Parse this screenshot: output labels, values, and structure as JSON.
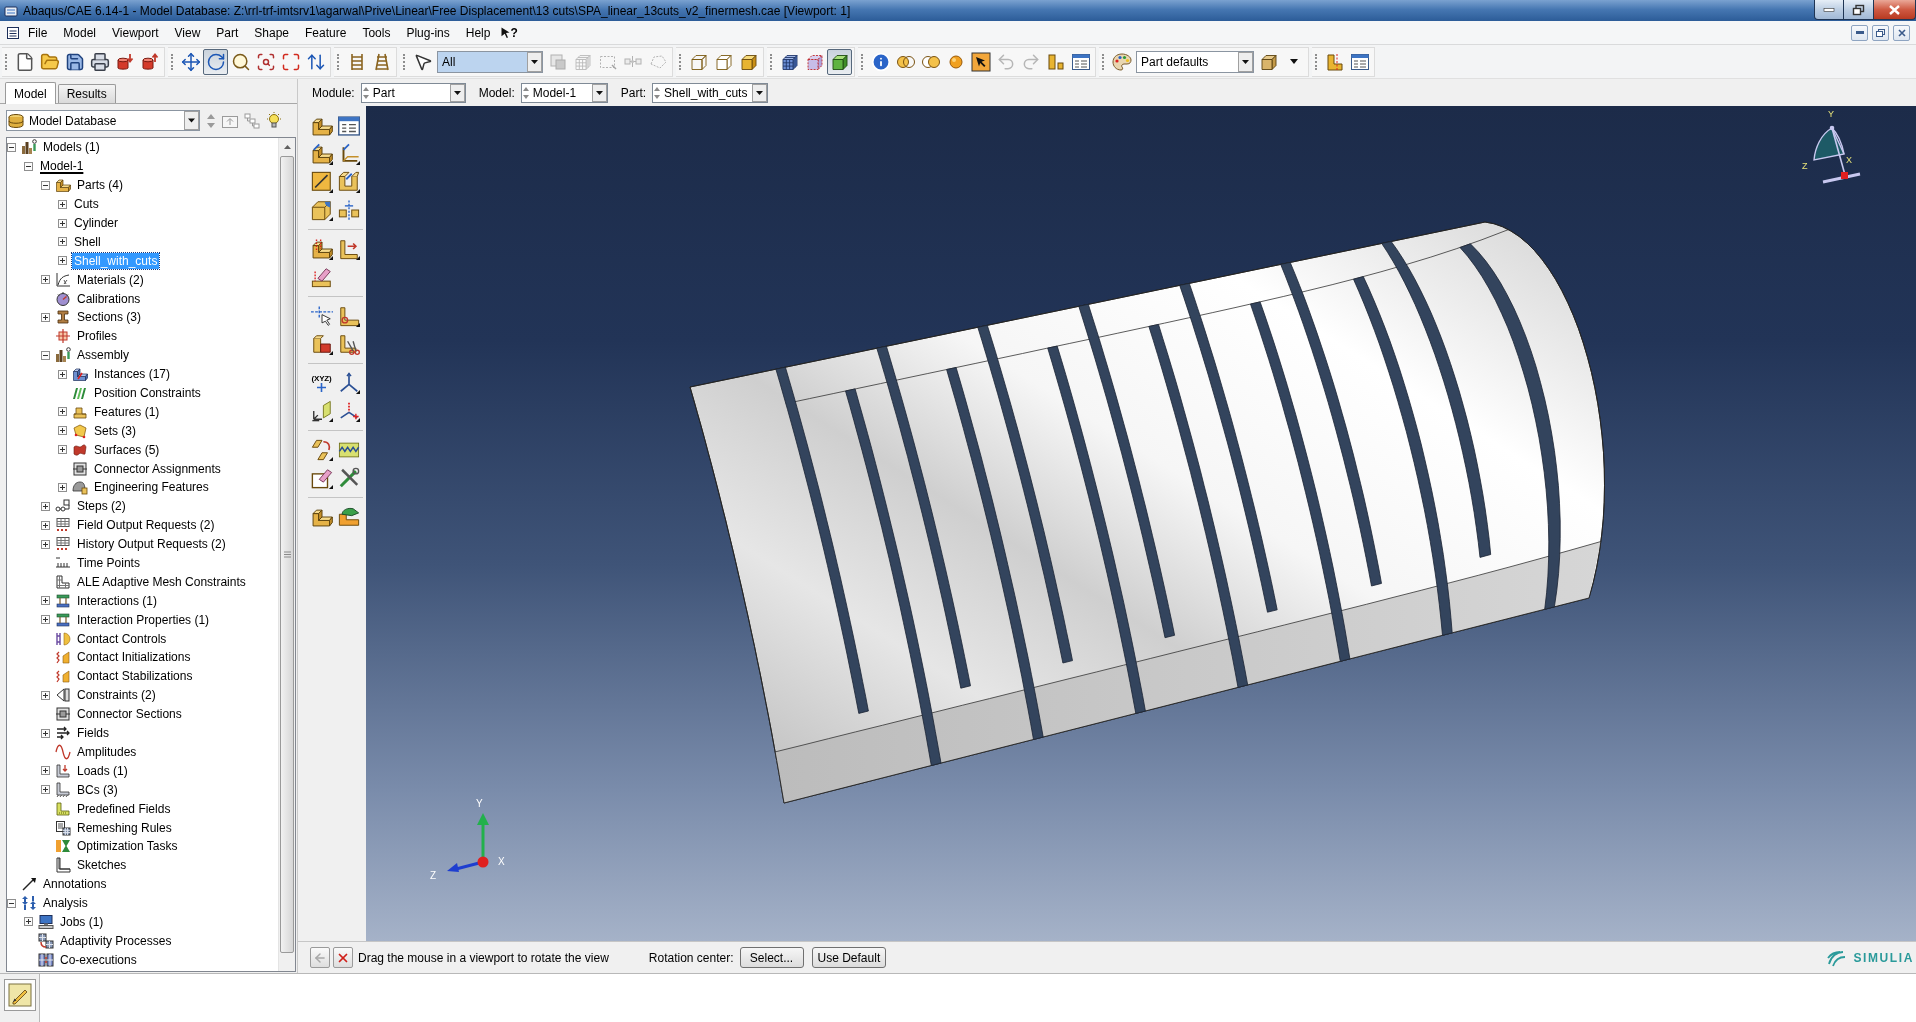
{
  "window": {
    "title": "Abaqus/CAE 6.14-1 - Model Database: Z:\\rrl-trf-imtsrv1\\agarwal\\Prive\\Linear\\Free Displacement\\13 cuts\\SPA_linear_13cuts_v2_finermesh.cae [Viewport: 1]"
  },
  "menu": {
    "items": [
      "File",
      "Model",
      "Viewport",
      "View",
      "Part",
      "Shape",
      "Feature",
      "Tools",
      "Plug-ins",
      "Help"
    ],
    "context_help": "?"
  },
  "toolbar": [
    [
      {
        "kind": "new",
        "pressed": false,
        "disabled": false
      },
      {
        "kind": "open",
        "pressed": false,
        "disabled": false
      },
      {
        "kind": "save",
        "pressed": false,
        "disabled": false
      },
      {
        "kind": "print",
        "pressed": false,
        "disabled": false
      },
      {
        "kind": "db_down",
        "pressed": false,
        "disabled": false
      },
      {
        "kind": "db_up",
        "pressed": false,
        "disabled": false
      }
    ],
    [
      {
        "kind": "pan",
        "pressed": false,
        "disabled": false
      },
      {
        "kind": "rotate",
        "pressed": true,
        "disabled": false
      },
      {
        "kind": "zoom",
        "pressed": false,
        "disabled": false
      },
      {
        "kind": "box_zoom",
        "pressed": false,
        "disabled": false
      },
      {
        "kind": "fit",
        "pressed": false,
        "disabled": false
      },
      {
        "kind": "cycle",
        "pressed": false,
        "disabled": false
      }
    ],
    [
      {
        "kind": "ladder",
        "pressed": false,
        "disabled": false
      },
      {
        "kind": "ladder_alt",
        "pressed": false,
        "disabled": false
      }
    ],
    [
      {
        "kind": "pointer",
        "pressed": false,
        "disabled": false
      },
      {
        "kind": "combo",
        "value": "All"
      },
      {
        "kind": "sel_a",
        "pressed": false,
        "disabled": true
      },
      {
        "kind": "sel_b",
        "pressed": false,
        "disabled": true
      },
      {
        "kind": "sel_c",
        "pressed": false,
        "disabled": true
      },
      {
        "kind": "sel_d",
        "pressed": false,
        "disabled": true
      },
      {
        "kind": "sel_e",
        "pressed": false,
        "disabled": true
      }
    ],
    [
      {
        "kind": "wire_cube",
        "pressed": false,
        "disabled": false
      },
      {
        "kind": "hidden_cube",
        "pressed": false,
        "disabled": false
      },
      {
        "kind": "shaded_cube",
        "pressed": false,
        "disabled": false
      }
    ],
    [
      {
        "kind": "mesh_cube",
        "pressed": false,
        "disabled": false
      },
      {
        "kind": "dashed_cube",
        "pressed": false,
        "disabled": false
      },
      {
        "kind": "green_cube",
        "pressed": true,
        "disabled": false
      }
    ],
    [
      {
        "kind": "info",
        "pressed": false,
        "disabled": false
      },
      {
        "kind": "rings",
        "pressed": false,
        "disabled": false
      },
      {
        "kind": "rings_alt",
        "pressed": false,
        "disabled": false
      },
      {
        "kind": "sphere",
        "pressed": false,
        "disabled": false
      },
      {
        "kind": "query",
        "pressed": false,
        "disabled": false
      },
      {
        "kind": "undo",
        "pressed": false,
        "disabled": true
      },
      {
        "kind": "redo",
        "pressed": false,
        "disabled": true
      },
      {
        "kind": "blocks",
        "pressed": false,
        "disabled": false
      },
      {
        "kind": "window",
        "pressed": false,
        "disabled": false
      }
    ],
    [
      {
        "kind": "palette",
        "pressed": false,
        "disabled": false
      },
      {
        "kind": "combo",
        "value": "Part defaults"
      },
      {
        "kind": "cube",
        "pressed": false,
        "disabled": false
      },
      {
        "kind": "caret",
        "pressed": false,
        "disabled": false
      }
    ],
    [
      {
        "kind": "cut_l",
        "pressed": false,
        "disabled": false
      },
      {
        "kind": "window",
        "pressed": false,
        "disabled": false
      }
    ]
  ],
  "panel_tabs": [
    {
      "label": "Model",
      "selected": true
    },
    {
      "label": "Results",
      "selected": false
    }
  ],
  "database": {
    "value": "Model Database"
  },
  "tree": [
    {
      "label": "Models (1)",
      "kind": "models",
      "selected": false,
      "expanded": true,
      "children": [
        {
          "label": "Model-1",
          "kind": "plain",
          "selected": false,
          "current": true,
          "expanded": true,
          "children": [
            {
              "label": "Parts (4)",
              "kind": "parts",
              "selected": false,
              "expanded": true,
              "children": [
                {
                  "label": "Cuts",
                  "kind": "plain",
                  "selected": false,
                  "expanded": false
                },
                {
                  "label": "Cylinder",
                  "kind": "plain",
                  "selected": false,
                  "expanded": false
                },
                {
                  "label": "Shell",
                  "kind": "plain",
                  "selected": false,
                  "expanded": false
                },
                {
                  "label": "Shell_with_cuts",
                  "kind": "plain",
                  "selected": true,
                  "expanded": false
                }
              ]
            },
            {
              "label": "Materials (2)",
              "kind": "materials",
              "selected": false,
              "expanded": false
            },
            {
              "label": "Calibrations",
              "kind": "calibrations",
              "selected": false
            },
            {
              "label": "Sections (3)",
              "kind": "sections",
              "selected": false,
              "expanded": false
            },
            {
              "label": "Profiles",
              "kind": "profiles",
              "selected": false
            },
            {
              "label": "Assembly",
              "kind": "assembly",
              "selected": false,
              "expanded": true,
              "children": [
                {
                  "label": "Instances (17)",
                  "kind": "instances",
                  "selected": false,
                  "expanded": false
                },
                {
                  "label": "Position Constraints",
                  "kind": "position",
                  "selected": false
                },
                {
                  "label": "Features (1)",
                  "kind": "features",
                  "selected": false,
                  "expanded": false
                },
                {
                  "label": "Sets (3)",
                  "kind": "sets",
                  "selected": false,
                  "expanded": false
                },
                {
                  "label": "Surfaces (5)",
                  "kind": "surfaces",
                  "selected": false,
                  "expanded": false
                },
                {
                  "label": "Connector Assignments",
                  "kind": "connector",
                  "selected": false
                },
                {
                  "label": "Engineering Features",
                  "kind": "engineering",
                  "selected": false,
                  "expanded": false
                }
              ]
            },
            {
              "label": "Steps (2)",
              "kind": "steps",
              "selected": false,
              "expanded": false
            },
            {
              "label": "Field Output Requests (2)",
              "kind": "output",
              "selected": false,
              "expanded": false
            },
            {
              "label": "History Output Requests (2)",
              "kind": "output",
              "selected": false,
              "expanded": false
            },
            {
              "label": "Time Points",
              "kind": "timepoints",
              "selected": false
            },
            {
              "label": "ALE Adaptive Mesh Constraints",
              "kind": "ale",
              "selected": false
            },
            {
              "label": "Interactions (1)",
              "kind": "interactions",
              "selected": false,
              "expanded": false
            },
            {
              "label": "Interaction Properties (1)",
              "kind": "interactions",
              "selected": false,
              "expanded": false
            },
            {
              "label": "Contact Controls",
              "kind": "contact",
              "selected": false
            },
            {
              "label": "Contact Initializations",
              "kind": "springs",
              "selected": false
            },
            {
              "label": "Contact Stabilizations",
              "kind": "springs",
              "selected": false
            },
            {
              "label": "Constraints (2)",
              "kind": "constraints",
              "selected": false,
              "expanded": false
            },
            {
              "label": "Connector Sections",
              "kind": "connector",
              "selected": false
            },
            {
              "label": "Fields",
              "kind": "fields",
              "selected": false,
              "expanded": false
            },
            {
              "label": "Amplitudes",
              "kind": "amplitudes",
              "selected": false
            },
            {
              "label": "Loads (1)",
              "kind": "loads",
              "selected": false,
              "expanded": false
            },
            {
              "label": "BCs (3)",
              "kind": "bcs",
              "selected": false,
              "expanded": false
            },
            {
              "label": "Predefined Fields",
              "kind": "predefined",
              "selected": false
            },
            {
              "label": "Remeshing Rules",
              "kind": "remeshing",
              "selected": false
            },
            {
              "label": "Optimization Tasks",
              "kind": "optimization",
              "selected": false
            },
            {
              "label": "Sketches",
              "kind": "sketches",
              "selected": false
            }
          ]
        }
      ]
    },
    {
      "label": "Annotations",
      "kind": "annotations",
      "selected": false
    },
    {
      "label": "Analysis",
      "kind": "analysis",
      "selected": false,
      "expanded": true,
      "children": [
        {
          "label": "Jobs (1)",
          "kind": "jobs",
          "selected": false,
          "expanded": false
        },
        {
          "label": "Adaptivity Processes",
          "kind": "adaptivity",
          "selected": false
        },
        {
          "label": "Co-executions",
          "kind": "coexec",
          "selected": false
        }
      ]
    }
  ],
  "context": [
    {
      "label": "Module:",
      "value": "Part"
    },
    {
      "label": "Model:",
      "value": "Model-1"
    },
    {
      "label": "Part:",
      "value": "Shell_with_cuts"
    }
  ],
  "toolbox": {
    "point_label": "(XYZ)"
  },
  "viewport": {
    "triad": [
      "Y",
      "Z",
      "X"
    ],
    "view_triad": [
      "Y",
      "Z",
      "X"
    ]
  },
  "prompt": {
    "back_disabled": true,
    "message": "Drag the mouse in a viewport to rotate the view",
    "rotation_label": "Rotation center:",
    "buttons": [
      "Select...",
      "Use Default"
    ]
  },
  "brand": "SIMULIA"
}
